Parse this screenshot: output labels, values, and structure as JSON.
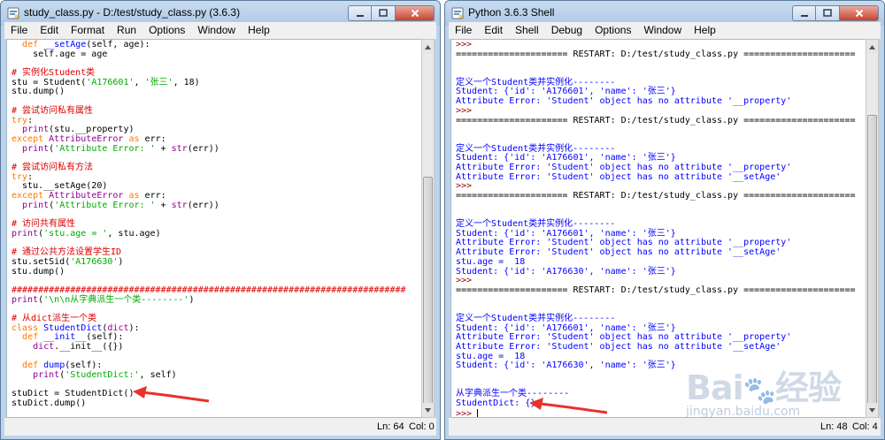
{
  "editor": {
    "title": "study_class.py - D:/test/study_class.py (3.6.3)",
    "menu": [
      "File",
      "Edit",
      "Format",
      "Run",
      "Options",
      "Window",
      "Help"
    ],
    "status": {
      "ln": "Ln: 64",
      "col": "Col: 0"
    },
    "lines": [
      [
        {
          "c": "t-norm",
          "t": "  "
        },
        {
          "c": "t-kw",
          "t": "def"
        },
        {
          "c": "t-norm",
          "t": " "
        },
        {
          "c": "t-def",
          "t": "__setAge"
        },
        {
          "c": "t-norm",
          "t": "(self, age):"
        }
      ],
      [
        {
          "c": "t-norm",
          "t": "    self.age = age"
        }
      ],
      [
        {
          "c": "t-norm",
          "t": ""
        }
      ],
      [
        {
          "c": "t-com",
          "t": "# 实例化Student类"
        }
      ],
      [
        {
          "c": "t-norm",
          "t": "stu = Student("
        },
        {
          "c": "t-str",
          "t": "'A176601'"
        },
        {
          "c": "t-norm",
          "t": ", "
        },
        {
          "c": "t-str",
          "t": "'张三'"
        },
        {
          "c": "t-norm",
          "t": ", 18)"
        }
      ],
      [
        {
          "c": "t-norm",
          "t": "stu.dump()"
        }
      ],
      [
        {
          "c": "t-norm",
          "t": ""
        }
      ],
      [
        {
          "c": "t-com",
          "t": "# 尝试访问私有属性"
        }
      ],
      [
        {
          "c": "t-kw",
          "t": "try"
        },
        {
          "c": "t-norm",
          "t": ":"
        }
      ],
      [
        {
          "c": "t-norm",
          "t": "  "
        },
        {
          "c": "t-bi",
          "t": "print"
        },
        {
          "c": "t-norm",
          "t": "(stu.__property)"
        }
      ],
      [
        {
          "c": "t-kw",
          "t": "except"
        },
        {
          "c": "t-norm",
          "t": " "
        },
        {
          "c": "t-bi",
          "t": "AttributeError"
        },
        {
          "c": "t-norm",
          "t": " "
        },
        {
          "c": "t-kw",
          "t": "as"
        },
        {
          "c": "t-norm",
          "t": " err:"
        }
      ],
      [
        {
          "c": "t-norm",
          "t": "  "
        },
        {
          "c": "t-bi",
          "t": "print"
        },
        {
          "c": "t-norm",
          "t": "("
        },
        {
          "c": "t-str",
          "t": "'Attribute Error: '"
        },
        {
          "c": "t-norm",
          "t": " + "
        },
        {
          "c": "t-bi",
          "t": "str"
        },
        {
          "c": "t-norm",
          "t": "(err))"
        }
      ],
      [
        {
          "c": "t-norm",
          "t": ""
        }
      ],
      [
        {
          "c": "t-com",
          "t": "# 尝试访问私有方法"
        }
      ],
      [
        {
          "c": "t-kw",
          "t": "try"
        },
        {
          "c": "t-norm",
          "t": ":"
        }
      ],
      [
        {
          "c": "t-norm",
          "t": "  stu.__setAge(20)"
        }
      ],
      [
        {
          "c": "t-kw",
          "t": "except"
        },
        {
          "c": "t-norm",
          "t": " "
        },
        {
          "c": "t-bi",
          "t": "AttributeError"
        },
        {
          "c": "t-norm",
          "t": " "
        },
        {
          "c": "t-kw",
          "t": "as"
        },
        {
          "c": "t-norm",
          "t": " err:"
        }
      ],
      [
        {
          "c": "t-norm",
          "t": "  "
        },
        {
          "c": "t-bi",
          "t": "print"
        },
        {
          "c": "t-norm",
          "t": "("
        },
        {
          "c": "t-str",
          "t": "'Attribute Error: '"
        },
        {
          "c": "t-norm",
          "t": " + "
        },
        {
          "c": "t-bi",
          "t": "str"
        },
        {
          "c": "t-norm",
          "t": "(err))"
        }
      ],
      [
        {
          "c": "t-norm",
          "t": ""
        }
      ],
      [
        {
          "c": "t-com",
          "t": "# 访问共有属性"
        }
      ],
      [
        {
          "c": "t-bi",
          "t": "print"
        },
        {
          "c": "t-norm",
          "t": "("
        },
        {
          "c": "t-str",
          "t": "'stu.age = '"
        },
        {
          "c": "t-norm",
          "t": ", stu.age)"
        }
      ],
      [
        {
          "c": "t-norm",
          "t": ""
        }
      ],
      [
        {
          "c": "t-com",
          "t": "# 通过公共方法设置学生ID"
        }
      ],
      [
        {
          "c": "t-norm",
          "t": "stu.setSid("
        },
        {
          "c": "t-str",
          "t": "'A176630'"
        },
        {
          "c": "t-norm",
          "t": ")"
        }
      ],
      [
        {
          "c": "t-norm",
          "t": "stu.dump()"
        }
      ],
      [
        {
          "c": "t-norm",
          "t": ""
        }
      ],
      [
        {
          "c": "t-com",
          "t": "##########################################################################"
        }
      ],
      [
        {
          "c": "t-bi",
          "t": "print"
        },
        {
          "c": "t-norm",
          "t": "("
        },
        {
          "c": "t-str",
          "t": "'\\n\\n从字典派生一个类--------'"
        },
        {
          "c": "t-norm",
          "t": ")"
        }
      ],
      [
        {
          "c": "t-norm",
          "t": ""
        }
      ],
      [
        {
          "c": "t-com",
          "t": "# 从dict派生一个类"
        }
      ],
      [
        {
          "c": "t-kw",
          "t": "class"
        },
        {
          "c": "t-norm",
          "t": " "
        },
        {
          "c": "t-def",
          "t": "StudentDict"
        },
        {
          "c": "t-norm",
          "t": "("
        },
        {
          "c": "t-bi",
          "t": "dict"
        },
        {
          "c": "t-norm",
          "t": "):"
        }
      ],
      [
        {
          "c": "t-norm",
          "t": "  "
        },
        {
          "c": "t-kw",
          "t": "def"
        },
        {
          "c": "t-norm",
          "t": " "
        },
        {
          "c": "t-def",
          "t": "__init__"
        },
        {
          "c": "t-norm",
          "t": "(self):"
        }
      ],
      [
        {
          "c": "t-norm",
          "t": "    "
        },
        {
          "c": "t-bi",
          "t": "dict"
        },
        {
          "c": "t-norm",
          "t": ".__init__({})"
        }
      ],
      [
        {
          "c": "t-norm",
          "t": ""
        }
      ],
      [
        {
          "c": "t-norm",
          "t": "  "
        },
        {
          "c": "t-kw",
          "t": "def"
        },
        {
          "c": "t-norm",
          "t": " "
        },
        {
          "c": "t-def",
          "t": "dump"
        },
        {
          "c": "t-norm",
          "t": "(self):"
        }
      ],
      [
        {
          "c": "t-norm",
          "t": "    "
        },
        {
          "c": "t-bi",
          "t": "print"
        },
        {
          "c": "t-norm",
          "t": "("
        },
        {
          "c": "t-str",
          "t": "'StudentDict:'"
        },
        {
          "c": "t-norm",
          "t": ", self)"
        }
      ],
      [
        {
          "c": "t-norm",
          "t": ""
        }
      ],
      [
        {
          "c": "t-norm",
          "t": "stuDict = StudentDict()"
        }
      ],
      [
        {
          "c": "t-norm",
          "t": "stuDict.dump()"
        }
      ]
    ]
  },
  "shell": {
    "title": "Python 3.6.3 Shell",
    "menu": [
      "File",
      "Edit",
      "Shell",
      "Debug",
      "Options",
      "Window",
      "Help"
    ],
    "status": {
      "ln": "Ln: 48",
      "col": "Col: 4"
    },
    "lines": [
      [
        {
          "c": "t-prompt",
          "t": ">>> "
        }
      ],
      [
        {
          "c": "t-restart",
          "t": "===================== RESTART: D:/test/study_class.py ====================="
        }
      ],
      [
        {
          "c": "t-norm",
          "t": ""
        }
      ],
      [
        {
          "c": "t-norm",
          "t": ""
        }
      ],
      [
        {
          "c": "t-out",
          "t": "定义一个Student类并实例化--------"
        }
      ],
      [
        {
          "c": "t-out",
          "t": "Student: {'id': 'A176601', 'name': '张三'}"
        }
      ],
      [
        {
          "c": "t-out",
          "t": "Attribute Error: 'Student' object has no attribute '__property'"
        }
      ],
      [
        {
          "c": "t-prompt",
          "t": ">>> "
        }
      ],
      [
        {
          "c": "t-restart",
          "t": "===================== RESTART: D:/test/study_class.py ====================="
        }
      ],
      [
        {
          "c": "t-norm",
          "t": ""
        }
      ],
      [
        {
          "c": "t-norm",
          "t": ""
        }
      ],
      [
        {
          "c": "t-out",
          "t": "定义一个Student类并实例化--------"
        }
      ],
      [
        {
          "c": "t-out",
          "t": "Student: {'id': 'A176601', 'name': '张三'}"
        }
      ],
      [
        {
          "c": "t-out",
          "t": "Attribute Error: 'Student' object has no attribute '__property'"
        }
      ],
      [
        {
          "c": "t-out",
          "t": "Attribute Error: 'Student' object has no attribute '__setAge'"
        }
      ],
      [
        {
          "c": "t-prompt",
          "t": ">>> "
        }
      ],
      [
        {
          "c": "t-restart",
          "t": "===================== RESTART: D:/test/study_class.py ====================="
        }
      ],
      [
        {
          "c": "t-norm",
          "t": ""
        }
      ],
      [
        {
          "c": "t-norm",
          "t": ""
        }
      ],
      [
        {
          "c": "t-out",
          "t": "定义一个Student类并实例化--------"
        }
      ],
      [
        {
          "c": "t-out",
          "t": "Student: {'id': 'A176601', 'name': '张三'}"
        }
      ],
      [
        {
          "c": "t-out",
          "t": "Attribute Error: 'Student' object has no attribute '__property'"
        }
      ],
      [
        {
          "c": "t-out",
          "t": "Attribute Error: 'Student' object has no attribute '__setAge'"
        }
      ],
      [
        {
          "c": "t-out",
          "t": "stu.age =  18"
        }
      ],
      [
        {
          "c": "t-out",
          "t": "Student: {'id': 'A176630', 'name': '张三'}"
        }
      ],
      [
        {
          "c": "t-prompt",
          "t": ">>> "
        }
      ],
      [
        {
          "c": "t-restart",
          "t": "===================== RESTART: D:/test/study_class.py ====================="
        }
      ],
      [
        {
          "c": "t-norm",
          "t": ""
        }
      ],
      [
        {
          "c": "t-norm",
          "t": ""
        }
      ],
      [
        {
          "c": "t-out",
          "t": "定义一个Student类并实例化--------"
        }
      ],
      [
        {
          "c": "t-out",
          "t": "Student: {'id': 'A176601', 'name': '张三'}"
        }
      ],
      [
        {
          "c": "t-out",
          "t": "Attribute Error: 'Student' object has no attribute '__property'"
        }
      ],
      [
        {
          "c": "t-out",
          "t": "Attribute Error: 'Student' object has no attribute '__setAge'"
        }
      ],
      [
        {
          "c": "t-out",
          "t": "stu.age =  18"
        }
      ],
      [
        {
          "c": "t-out",
          "t": "Student: {'id': 'A176630', 'name': '张三'}"
        }
      ],
      [
        {
          "c": "t-norm",
          "t": ""
        }
      ],
      [
        {
          "c": "t-norm",
          "t": ""
        }
      ],
      [
        {
          "c": "t-out",
          "t": "从字典派生一个类--------"
        }
      ],
      [
        {
          "c": "t-out",
          "t": "StudentDict: {}"
        }
      ],
      [
        {
          "c": "t-prompt",
          "t": ">>> "
        }
      ]
    ]
  },
  "watermark": {
    "logo": "Bai 经验",
    "url": "jingyan.baidu.com"
  },
  "colors": {
    "annotation_arrow": "#e8322a",
    "titlebar": "#bcd3ea",
    "close_button": "#c7432e"
  },
  "icons": {
    "title": "python-idle-icon",
    "minimize": "minimize-icon",
    "maximize": "maximize-icon",
    "close": "close-icon"
  }
}
